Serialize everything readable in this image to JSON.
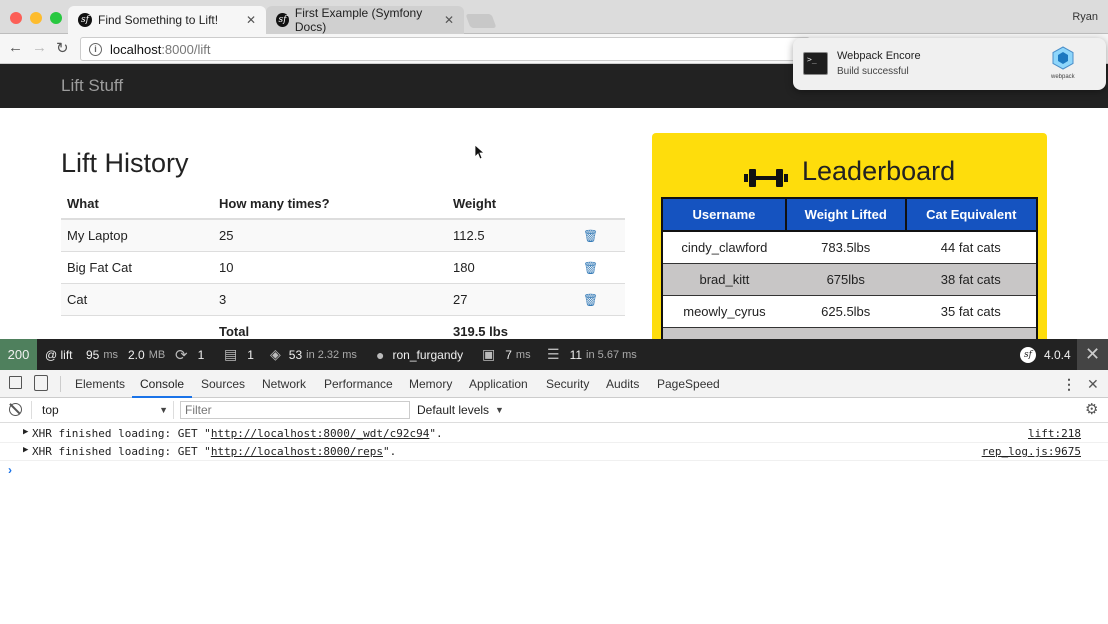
{
  "browser": {
    "tabs": [
      {
        "title": "Find Something to Lift!"
      },
      {
        "title": "First Example (Symfony Docs)"
      }
    ],
    "profile_name": "Ryan",
    "url_host": "localhost",
    "url_rest": ":8000/lift"
  },
  "notification": {
    "title": "Webpack Encore",
    "message": "Build successful",
    "logo_text": "webpack"
  },
  "site": {
    "brand": "Lift Stuff"
  },
  "lift_history": {
    "title": "Lift History",
    "headers": [
      "What",
      "How many times?",
      "Weight"
    ],
    "rows": [
      {
        "what": "My Laptop",
        "times": "25",
        "weight": "112.5"
      },
      {
        "what": "Big Fat Cat",
        "times": "10",
        "weight": "180"
      },
      {
        "what": "Cat",
        "times": "3",
        "weight": "27"
      }
    ],
    "total_label": "Total",
    "total_value": "319.5 lbs"
  },
  "leaderboard": {
    "title": "Leaderboard",
    "headers": [
      "Username",
      "Weight Lifted",
      "Cat Equivalent"
    ],
    "rows": [
      {
        "username": "cindy_clawford",
        "weight": "783.5lbs",
        "cats": "44 fat cats"
      },
      {
        "username": "brad_kitt",
        "weight": "675lbs",
        "cats": "38 fat cats"
      },
      {
        "username": "meowly_cyrus",
        "weight": "625.5lbs",
        "cats": "35 fat cats"
      }
    ]
  },
  "symfony_toolbar": {
    "status": "200",
    "route": "@ lift",
    "time_value": "95",
    "time_unit": "ms",
    "memory_value": "2.0",
    "memory_unit": "MB",
    "ajax_count": "1",
    "forms_count": "1",
    "templates_value": "53",
    "templates_unit": "in 2.32 ms",
    "user": "ron_furgandy",
    "cache_value": "7",
    "cache_unit": "ms",
    "db_value": "11",
    "db_unit": "in 5.67 ms",
    "version": "4.0.4",
    "status_color": "#4f805d"
  },
  "devtools": {
    "tabs": [
      "Elements",
      "Console",
      "Sources",
      "Network",
      "Performance",
      "Memory",
      "Application",
      "Security",
      "Audits",
      "PageSpeed"
    ],
    "active_tab": "Console",
    "context": "top",
    "filter_placeholder": "Filter",
    "levels": "Default levels",
    "logs": [
      {
        "prefix": "XHR finished loading: GET \"",
        "link": "http://localhost:8000/_wdt/c92c94",
        "suffix": "\".",
        "source": "lift:218"
      },
      {
        "prefix": "XHR finished loading: GET \"",
        "link": "http://localhost:8000/reps",
        "suffix": "\".",
        "source": "rep_log.js:9675"
      }
    ]
  }
}
